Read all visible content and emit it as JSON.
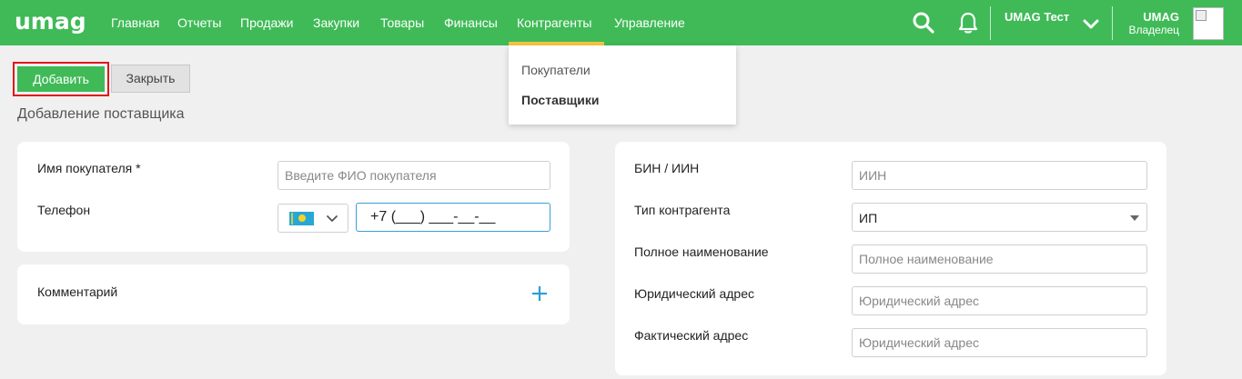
{
  "app": {
    "logo": "umag"
  },
  "nav": {
    "items": [
      "Главная",
      "Отчеты",
      "Продажи",
      "Закупки",
      "Товары",
      "Финансы",
      "Контрагенты",
      "Управление"
    ],
    "active": "Контрагенты"
  },
  "topbar": {
    "store_name": "UMAG Тест",
    "user_name": "UMAG",
    "user_role": "Владелец"
  },
  "dropdown": {
    "items": [
      "Покупатели",
      "Поставщики"
    ],
    "selected": "Поставщики"
  },
  "actions": {
    "add_label": "Добавить",
    "close_label": "Закрыть"
  },
  "page": {
    "title": "Добавление поставщика"
  },
  "left_card": {
    "name_label": "Имя покупателя *",
    "name_placeholder": "Введите ФИО покупателя",
    "phone_label": "Телефон",
    "phone_value": "+7 (___) ___-__-__"
  },
  "comment_card": {
    "label": "Комментарий"
  },
  "right_card": {
    "bin_label": "БИН / ИИН",
    "bin_placeholder": "ИИН",
    "type_label": "Тип контрагента",
    "type_value": "ИП",
    "fullname_label": "Полное наименование",
    "fullname_placeholder": "Полное наименование",
    "legal_address_label": "Юридический адрес",
    "legal_address_placeholder": "Юридический адрес",
    "actual_address_label": "Фактический адрес",
    "actual_address_placeholder": "Юридический адрес"
  },
  "colors": {
    "brand_green": "#3fba57",
    "active_tab": "#f5c542",
    "focus_blue": "#3a9fd8",
    "highlight_red": "#e0161c"
  }
}
